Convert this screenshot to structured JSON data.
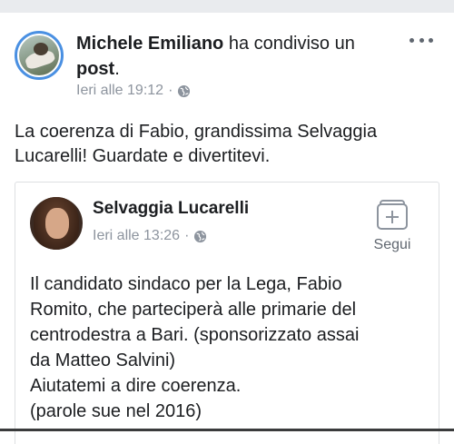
{
  "post": {
    "author": "Michele Emiliano",
    "action": "ha condiviso un",
    "object": "post",
    "punct": ".",
    "timestamp": "Ieri alle 19:12",
    "separator": "·",
    "text": "La coerenza di Fabio, grandissima Selvaggia Lucarelli! Guardate e divertitevi."
  },
  "shared": {
    "author": "Selvaggia Lucarelli",
    "timestamp": "Ieri alle 13:26",
    "separator": "·",
    "follow_label": "Segui",
    "lines": [
      "Il candidato sindaco per la Lega, Fabio",
      "Romito, che parteciperà alle primarie del",
      "centrodestra a Bari. (sponsorizzato assai",
      "da Matteo Salvini)",
      "Aiutatemi a dire coerenza.",
      "(parole sue nel 2016)"
    ]
  },
  "icons": {
    "privacy": "globe-icon",
    "more": "more-options-icon",
    "follow": "follow-icon"
  },
  "colors": {
    "name_text": "#1c1e21",
    "meta_text": "#8d949e",
    "avatar_ring": "#4a90e2"
  }
}
